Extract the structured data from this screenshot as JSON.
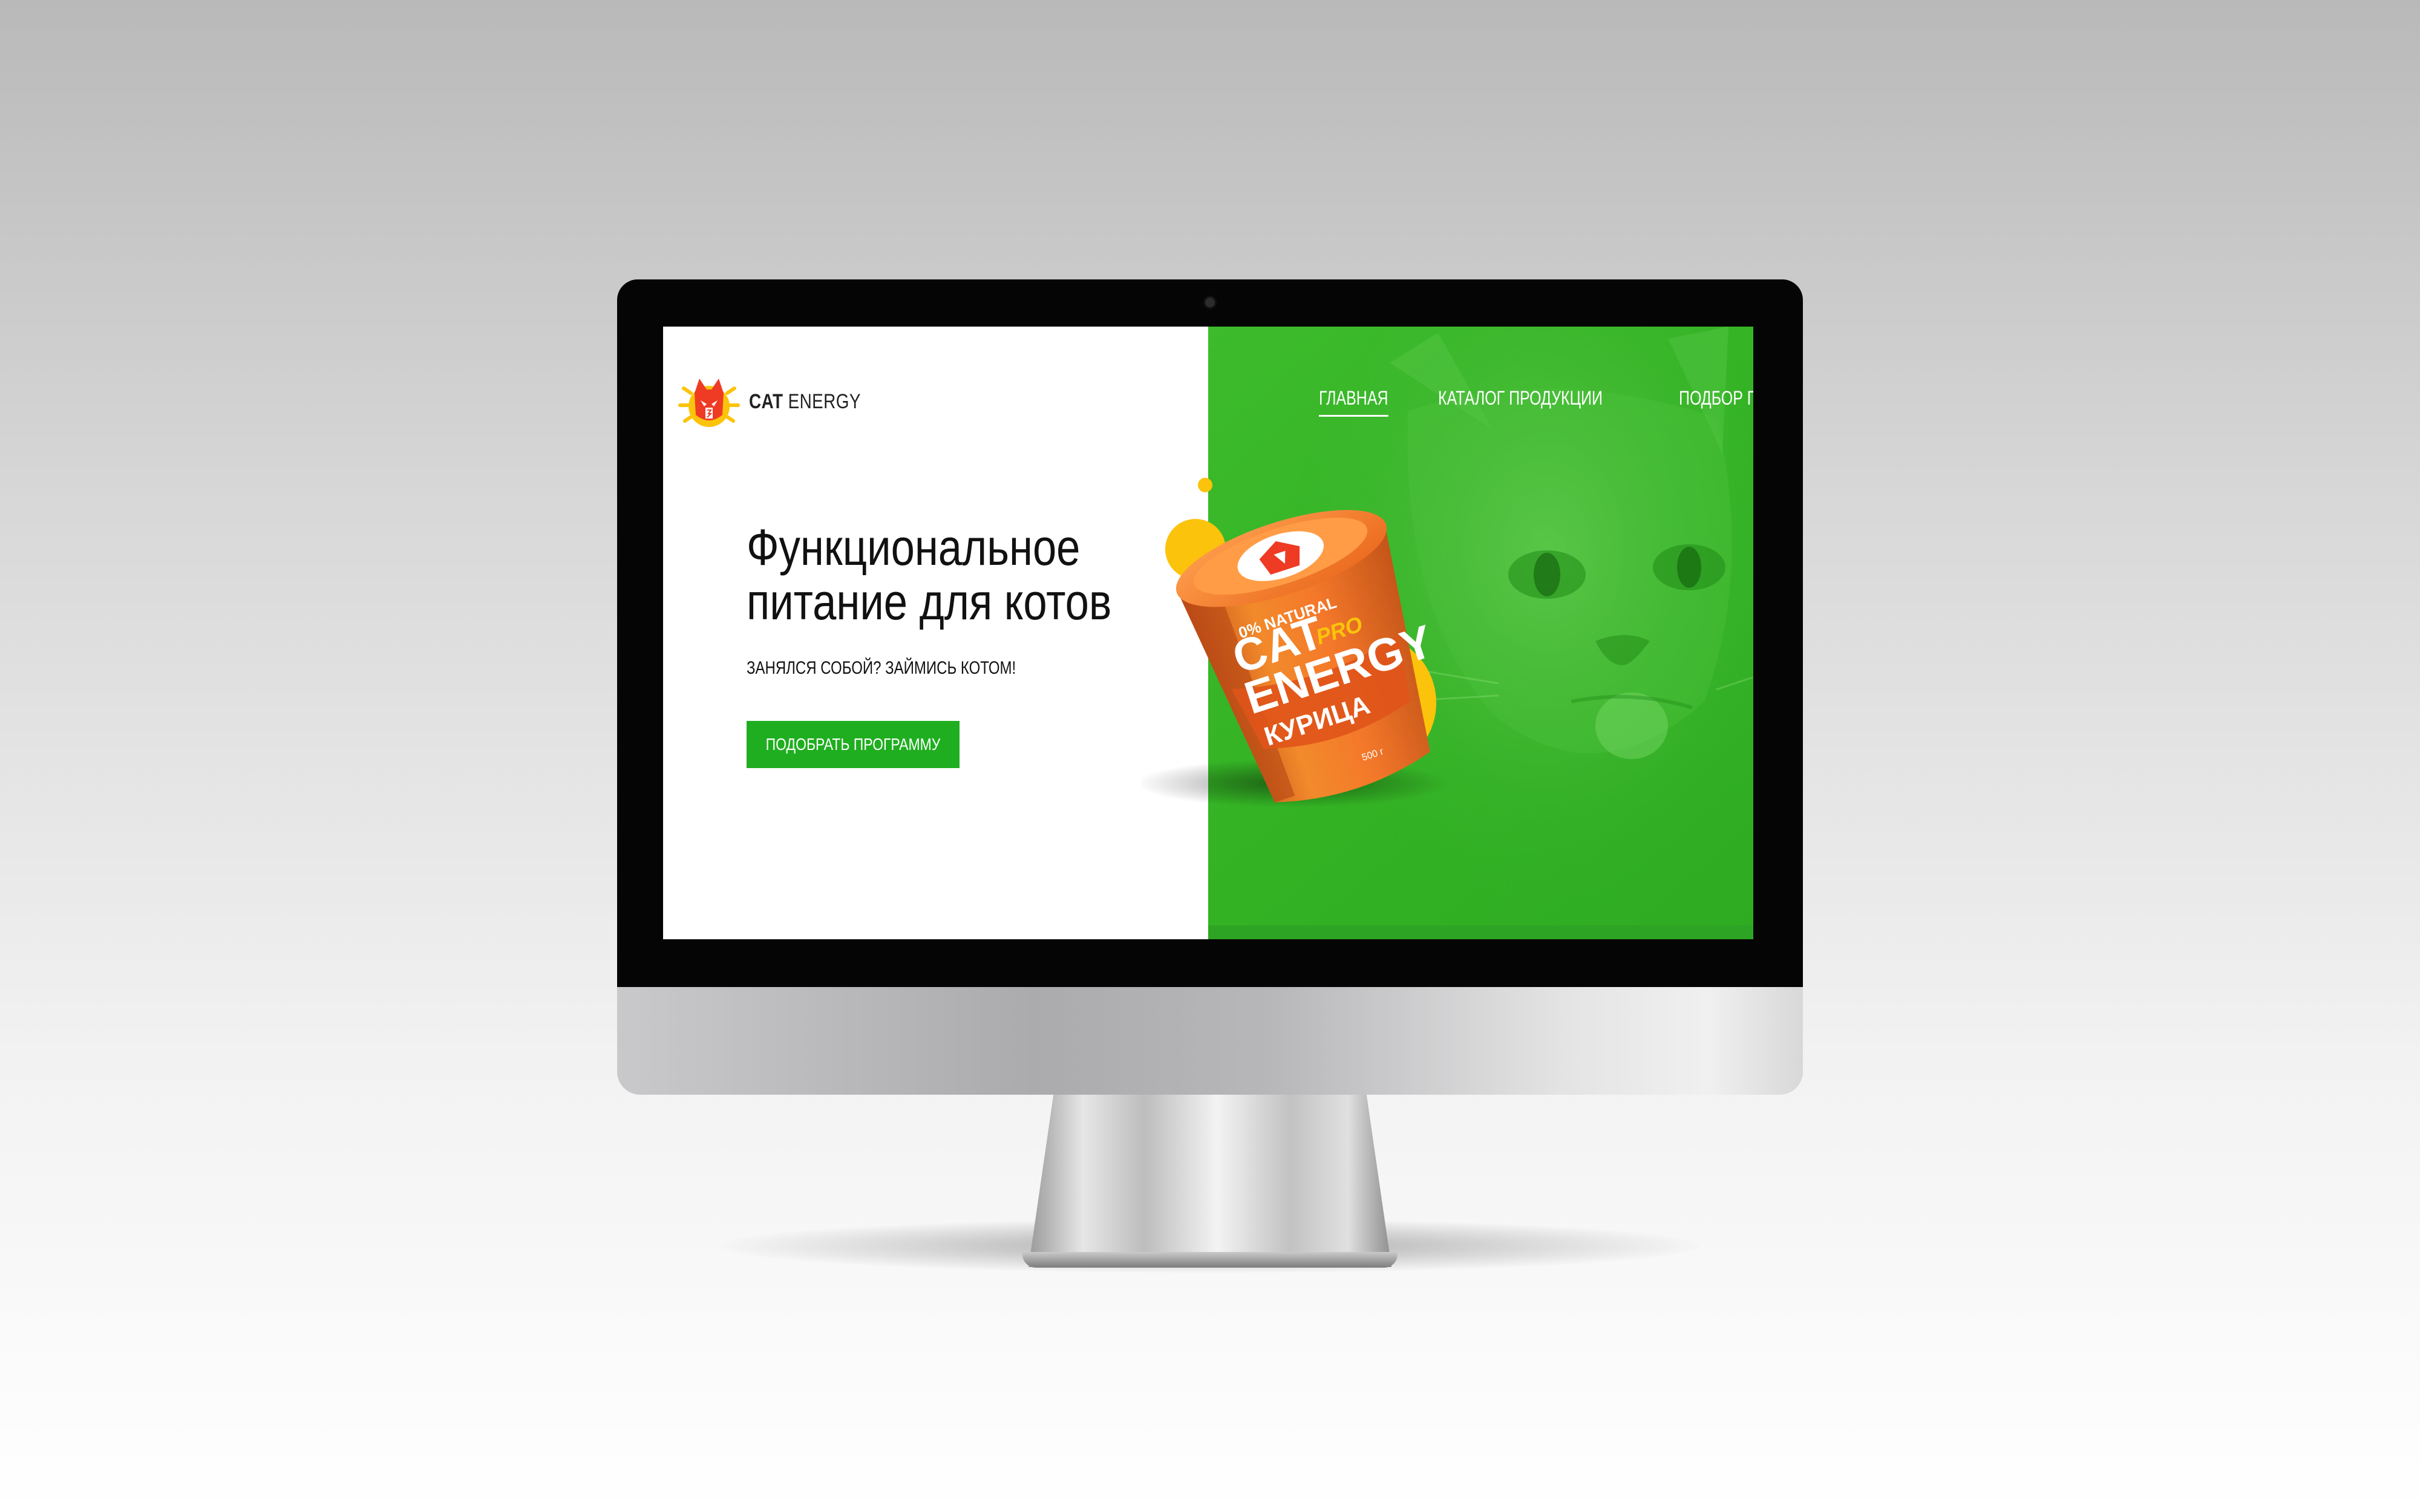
{
  "brand": {
    "cat": "CAT",
    "energy": "ENERGY"
  },
  "nav": {
    "items": [
      {
        "label": "ГЛАВНАЯ",
        "active": true
      },
      {
        "label": "КАТАЛОГ ПРОДУКЦИИ",
        "active": false
      },
      {
        "label": "ПОДБОР ПРОГРАММЫ",
        "active": false
      }
    ]
  },
  "hero": {
    "title": "Функциональное питание для котов",
    "subtitle": "ЗАНЯЛСЯ СОБОЙ? ЗАЙМИСЬ КОТОМ!",
    "cta": "ПОДОБРАТЬ ПРОГРАММУ"
  },
  "product": {
    "natural": "0% NATURAL",
    "line1": "CAT",
    "line2": "ENERGY",
    "pro": "PRO",
    "flavor": "КУРИЦА",
    "weight": "500 г"
  },
  "colors": {
    "accent_green": "#1fae1f",
    "panel_green": "#35b326",
    "yellow": "#fbc30b",
    "orange": "#f07a1e"
  },
  "icons": [
    "cat-logo-icon",
    "cat-photo",
    "product-container"
  ]
}
